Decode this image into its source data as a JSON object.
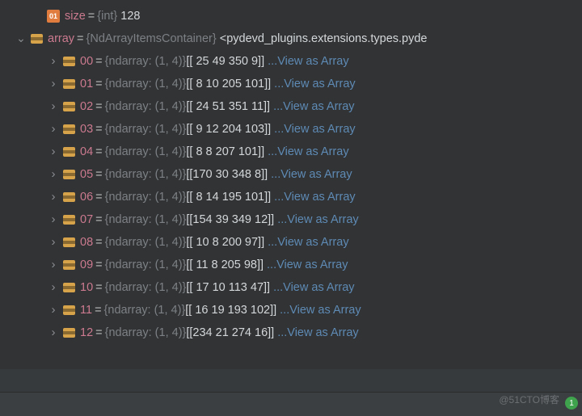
{
  "sizeRow": {
    "iconText": "01",
    "name": "size",
    "type": "{int}",
    "value": "128"
  },
  "arrayRow": {
    "name": "array",
    "type": "{NdArrayItemsContainer}",
    "value": "<pydevd_plugins.extensions.types.pyde"
  },
  "itemType": "{ndarray: (1, 4)}",
  "linkText": "...View as Array",
  "items": [
    {
      "idx": "00",
      "val": "[[ 25  49 350   9]]"
    },
    {
      "idx": "01",
      "val": "[[  8  10 205 101]]"
    },
    {
      "idx": "02",
      "val": "[[ 24  51 351  11]]"
    },
    {
      "idx": "03",
      "val": "[[  9  12 204 103]]"
    },
    {
      "idx": "04",
      "val": "[[  8   8 207 101]]"
    },
    {
      "idx": "05",
      "val": "[[170  30 348   8]]"
    },
    {
      "idx": "06",
      "val": "[[  8  14 195 101]]"
    },
    {
      "idx": "07",
      "val": "[[154  39 349  12]]"
    },
    {
      "idx": "08",
      "val": "[[ 10   8 200  97]]"
    },
    {
      "idx": "09",
      "val": "[[ 11   8 205  98]]"
    },
    {
      "idx": "10",
      "val": "[[ 17  10 113  47]]"
    },
    {
      "idx": "11",
      "val": "[[ 16  19 193 102]]"
    },
    {
      "idx": "12",
      "val": "[[234  21 274  16]]"
    }
  ],
  "watermark": "@51CTO博客",
  "badge": "1"
}
